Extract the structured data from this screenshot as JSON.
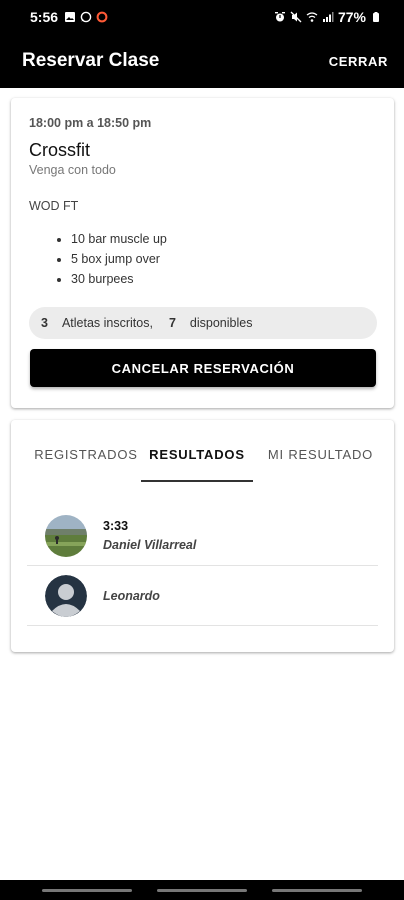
{
  "status_bar": {
    "time": "5:56",
    "battery": "77%"
  },
  "app_bar": {
    "title": "Reservar Clase",
    "close_label": "CERRAR"
  },
  "class_card": {
    "time_range": "18:00 pm a 18:50 pm",
    "name": "Crossfit",
    "subtitle": "Venga con todo",
    "wod_title": "WOD FT",
    "wod_items": [
      "10 bar muscle up",
      "5 box jump over",
      "30 burpees"
    ],
    "enrolled_count": "3",
    "enrolled_label": "Atletas inscritos,",
    "available_count": "7",
    "available_label": "disponibles",
    "cancel_label": "CANCELAR RESERVACIÓN"
  },
  "tabs": [
    {
      "label": "REGISTRADOS",
      "active": false
    },
    {
      "label": "RESULTADOS",
      "active": true
    },
    {
      "label": "MI RESULTADO",
      "active": false
    }
  ],
  "results": [
    {
      "score": "3:33",
      "name": "Daniel Villarreal",
      "avatar": "photo"
    },
    {
      "score": "",
      "name": "Leonardo",
      "avatar": "default-person-icon"
    }
  ]
}
